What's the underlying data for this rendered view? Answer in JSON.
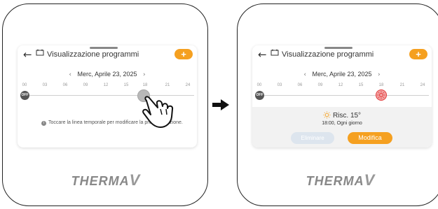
{
  "left_screen": {
    "title": "Visualizzazione programmi",
    "add_label": "+",
    "date": "Merc, Aprile 23, 2025",
    "prev": "‹",
    "next": "›",
    "ticks": [
      "00",
      "03",
      "06",
      "09",
      "12",
      "15",
      "18",
      "21",
      "24"
    ],
    "off_label": "OFF",
    "info_text": "Toccare la linea temporale per modificare la programmazione.",
    "info_icon_label": "i"
  },
  "right_screen": {
    "title": "Visualizzazione programmi",
    "add_label": "+",
    "date": "Merc, Aprile 23, 2025",
    "prev": "‹",
    "next": "›",
    "ticks": [
      "00",
      "03",
      "06",
      "09",
      "12",
      "15",
      "18",
      "21",
      "24"
    ],
    "off_label": "OFF",
    "mode_temp": "Risc. 15°",
    "schedule": "18:00, Ogni giorno",
    "delete_label": "Eliminare",
    "modify_label": "Modifica"
  },
  "brand": {
    "name": "THERMA",
    "suffix": "V"
  },
  "icons": {
    "back": "back-arrow-icon",
    "view": "program-view-icon",
    "sun": "sun-icon",
    "hand": "pointing-hand-icon",
    "arrow": "right-arrow-icon"
  },
  "colors": {
    "accent": "#f5a020",
    "heat": "#e23a3a"
  }
}
